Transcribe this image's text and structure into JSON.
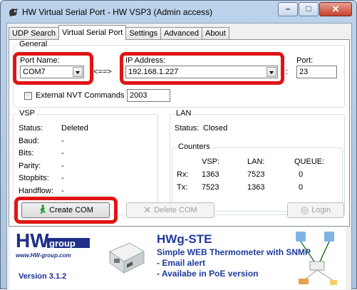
{
  "window": {
    "title": "HW Virtual Serial Port - HW VSP3 (Admin access)",
    "minimize_glyph": "–",
    "maximize_glyph": "□",
    "close_glyph": "✕"
  },
  "tabs": [
    "UDP Search",
    "Virtual Serial Port",
    "Settings",
    "Advanced",
    "About"
  ],
  "general": {
    "group_label": "General",
    "port_name_label": "Port Name:",
    "port_name_value": "COM7",
    "arrow": "<==>",
    "ip_label": "IP Address:",
    "ip_value": "192.168.1.227",
    "port_label": "Port:",
    "colon": ":",
    "port_value": "23",
    "nvt_label": "External NVT Commands Port:",
    "nvt_value": "2003"
  },
  "vsp": {
    "group_label": "VSP",
    "rows": [
      {
        "label": "Status:",
        "value": "Deleted"
      },
      {
        "label": "Baud:",
        "value": "-"
      },
      {
        "label": "Bits:",
        "value": "-"
      },
      {
        "label": "Parity:",
        "value": "-"
      },
      {
        "label": "Stopbits:",
        "value": "-"
      },
      {
        "label": "Handflow:",
        "value": "-"
      }
    ]
  },
  "lan": {
    "group_label": "LAN",
    "status_label": "Status:",
    "status_value": "Closed",
    "counters": {
      "group_label": "Counters",
      "headers": [
        "VSP:",
        "LAN:",
        "QUEUE:"
      ],
      "rows": [
        {
          "label": "Rx:",
          "values": [
            "1363",
            "7523",
            "0"
          ]
        },
        {
          "label": "Tx:",
          "values": [
            "7523",
            "1363",
            "0"
          ]
        }
      ]
    }
  },
  "buttons": {
    "create": "Create COM",
    "delete": "Delete COM",
    "login": "Login"
  },
  "banner": {
    "logo_text": "HW group",
    "logo_url": "www.HW-group.com",
    "version": "Version 3.1.2",
    "title": "HWg-STE",
    "line1": "Simple WEB Thermometer with SNMP",
    "line2": "- Email alert",
    "line3": "- Availabe in PoE version"
  },
  "colors": {
    "highlight": "#e01414",
    "banner_text": "#1f3a9a"
  }
}
